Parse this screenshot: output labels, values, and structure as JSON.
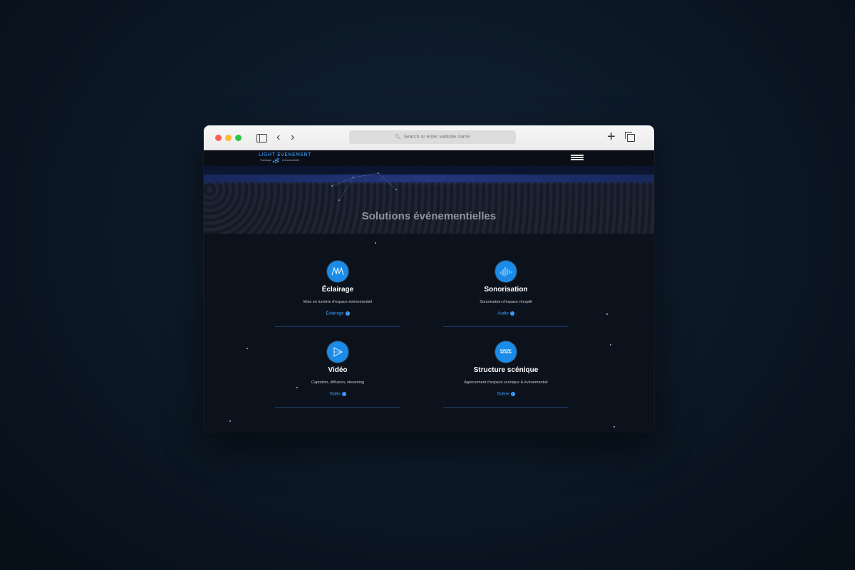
{
  "browser": {
    "address_placeholder": "Search or enter website name",
    "icons": [
      "sidebar-icon",
      "back-arrow-icon",
      "forward-arrow-icon",
      "search-icon",
      "plus-icon",
      "tabs-icon"
    ]
  },
  "site": {
    "logo": {
      "name": "LIGHT ÉVÉNEMENT",
      "tagline_left": "Technique",
      "tagline_right": "événementielle"
    },
    "hero_title": "Solutions événementielles",
    "services": [
      {
        "title": "Éclairage",
        "description": "Mise en lumière d'espace événementiel",
        "link": "Éclairage",
        "icon": "lighting-icon"
      },
      {
        "title": "Sonorisation",
        "description": "Sonorisation d'espace réceptif",
        "link": "Audio",
        "icon": "audio-icon"
      },
      {
        "title": "Vidéo",
        "description": "Captation, diffusion, streaming",
        "link": "Vidéo",
        "icon": "video-icon"
      },
      {
        "title": "Structure scénique",
        "description": "Agencement d'espace scénique & événementiel",
        "link": "Scène",
        "icon": "stage-icon"
      }
    ],
    "colors": {
      "accent": "#1a8be8",
      "link": "#3da0ff",
      "background": "#0c121c"
    }
  }
}
